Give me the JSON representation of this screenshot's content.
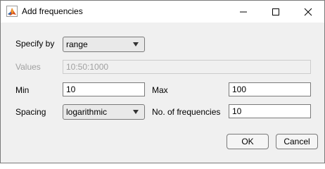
{
  "window": {
    "title": "Add frequencies"
  },
  "form": {
    "specify_by": {
      "label": "Specify by",
      "value": "range"
    },
    "values": {
      "label": "Values",
      "value": "10:50:1000"
    },
    "min": {
      "label": "Min",
      "value": "10"
    },
    "max": {
      "label": "Max",
      "value": "100"
    },
    "spacing": {
      "label": "Spacing",
      "value": "logarithmic"
    },
    "num_freq": {
      "label": "No. of frequencies",
      "value": "10"
    }
  },
  "buttons": {
    "ok": "OK",
    "cancel": "Cancel"
  }
}
